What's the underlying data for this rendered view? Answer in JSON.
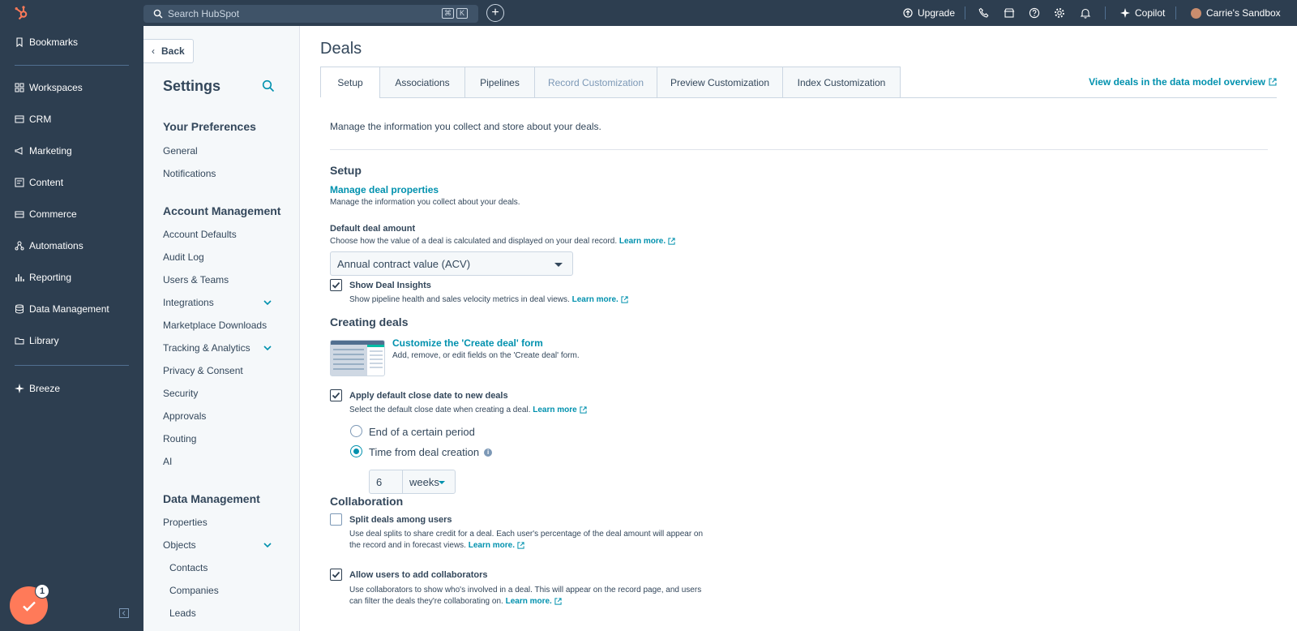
{
  "topbar": {
    "search_placeholder": "Search HubSpot",
    "kbd_cmd": "⌘",
    "kbd_k": "K",
    "upgrade": "Upgrade",
    "copilot": "Copilot",
    "account": "Carrie's Sandbox"
  },
  "leftnav": {
    "items": [
      "Bookmarks",
      "Workspaces",
      "CRM",
      "Marketing",
      "Content",
      "Commerce",
      "Automations",
      "Reporting",
      "Data Management",
      "Library",
      "Breeze"
    ],
    "fab_badge": "1"
  },
  "settings": {
    "back": "Back",
    "title": "Settings",
    "your_preferences": "Your Preferences",
    "prefs": [
      "General",
      "Notifications"
    ],
    "account_management": "Account Management",
    "account_items": [
      "Account Defaults",
      "Audit Log",
      "Users & Teams",
      "Integrations",
      "Marketplace Downloads",
      "Tracking & Analytics",
      "Privacy & Consent",
      "Security",
      "Approvals",
      "Routing",
      "AI"
    ],
    "data_management": "Data Management",
    "data_items": [
      "Properties",
      "Objects"
    ],
    "object_items": [
      "Contacts",
      "Companies",
      "Leads"
    ]
  },
  "main": {
    "title": "Deals",
    "tabs": [
      "Setup",
      "Associations",
      "Pipelines",
      "Record Customization",
      "Preview Customization",
      "Index Customization"
    ],
    "overview_link": "View deals in the data model overview",
    "intro": "Manage the information you collect and store about your deals.",
    "setup": {
      "heading": "Setup",
      "manage_link": "Manage deal properties",
      "manage_desc": "Manage the information you collect about your deals.",
      "default_amount_label": "Default deal amount",
      "default_amount_desc": "Choose how the value of a deal is calculated and displayed on your deal record.",
      "learn_more": "Learn more.",
      "default_amount_value": "Annual contract value (ACV)",
      "insights_label": "Show Deal Insights",
      "insights_desc": "Show pipeline health and sales velocity metrics in deal views."
    },
    "creating": {
      "heading": "Creating deals",
      "customize_link": "Customize the 'Create deal' form",
      "customize_desc": "Add, remove, or edit fields on the 'Create deal' form.",
      "close_date_label": "Apply default close date to new deals",
      "close_date_desc": "Select the default close date when creating a deal.",
      "learn_more_plain": "Learn more",
      "option_period": "End of a certain period",
      "option_creation": "Time from deal creation",
      "weeks_value": "6",
      "weeks_unit": "weeks"
    },
    "collab": {
      "heading": "Collaboration",
      "split_label": "Split deals among users",
      "split_desc_1": "Use deal splits to share credit for a deal. Each user's percentage of the deal amount will appear on",
      "split_desc_2": "the record and in forecast views.",
      "collab_label": "Allow users to add collaborators",
      "collab_desc_1": "Use collaborators to show who's involved in a deal. This will appear on the record page, and users",
      "collab_desc_2": "can filter the deals they're collaborating on.",
      "learn_more": "Learn more."
    }
  },
  "colors": {
    "topbar_bg": "#2d3e50",
    "link": "#0091ae",
    "accent_orange": "#ff7a59",
    "text": "#33475b"
  }
}
